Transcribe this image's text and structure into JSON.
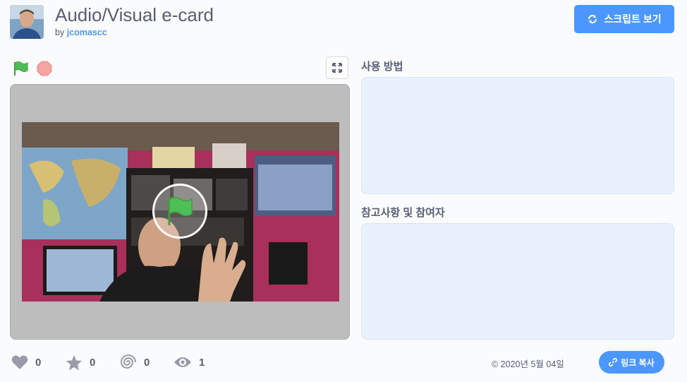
{
  "project": {
    "title": "Audio/Visual e-card",
    "by_label": "by",
    "author": "jcomascc"
  },
  "header": {
    "see_inside_label": "스크립트 보기",
    "see_inside_icon": "refresh-icon"
  },
  "sections": {
    "instructions_label": "사용 방법",
    "notes_label": "참고사항 및 참여자"
  },
  "stats": {
    "loves": "0",
    "favorites": "0",
    "remixes": "0",
    "views": "1"
  },
  "footer": {
    "shared_date": "© 2020년 5월 04일",
    "copy_link_label": "링크 복사"
  },
  "colors": {
    "accent": "#4c97ff",
    "flag_green": "#4cbf56",
    "stop_red": "#ec5959",
    "panel_bg": "#e9f1fc"
  }
}
